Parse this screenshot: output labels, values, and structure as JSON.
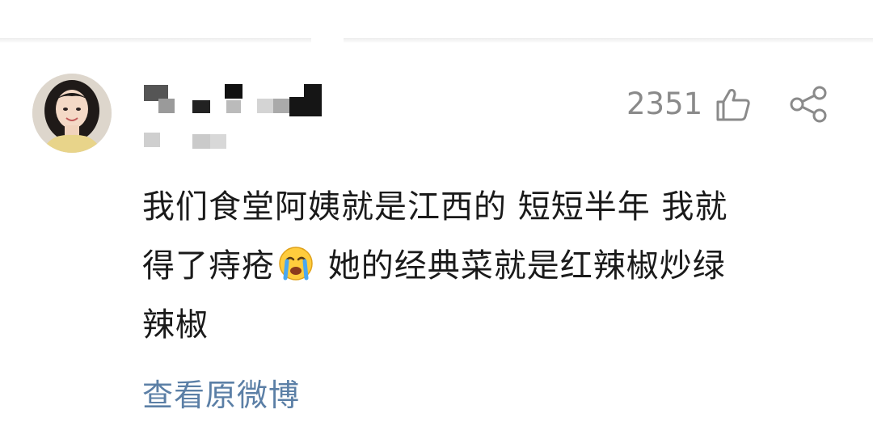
{
  "comment": {
    "like_count": "2351",
    "line1": "我们食堂阿姨就是江西的 短短半年 我就",
    "line2_before_emoji": "得了痔疮",
    "line2_after_emoji": " 她的经典菜就是红辣椒炒绿",
    "line3": "辣椒",
    "emoji_name": "crying-face-emoji",
    "view_original_label": "查看原微博"
  },
  "icons": {
    "like": "thumbs-up-icon",
    "share": "share-icon"
  },
  "colors": {
    "text": "#1a1a1a",
    "meta": "#8a8a8a",
    "link": "#5b7fa6"
  }
}
